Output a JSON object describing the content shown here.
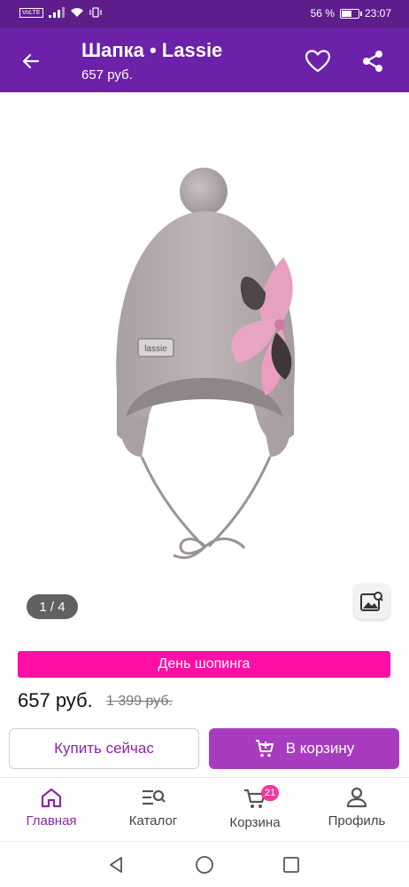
{
  "status_bar": {
    "network": "VoLTE",
    "battery_level": 0.56,
    "battery_percent": "56 %",
    "time": "23:07"
  },
  "header": {
    "title": "Шапка • Lassie",
    "subtitle": "657 руб."
  },
  "gallery": {
    "counter": "1 / 4",
    "image_label": "lassie"
  },
  "promo": {
    "label": "День шопинга"
  },
  "pricing": {
    "price": "657 руб.",
    "old_price": "1 399 руб."
  },
  "actions": {
    "buy_now": "Купить сейчас",
    "add_to_cart": "В корзину"
  },
  "bottom_nav": {
    "items": [
      {
        "label": "Главная",
        "icon": "home-icon",
        "active": true
      },
      {
        "label": "Каталог",
        "icon": "catalog-search-icon",
        "active": false
      },
      {
        "label": "Корзина",
        "icon": "cart-icon",
        "active": false,
        "badge": "21"
      },
      {
        "label": "Профиль",
        "icon": "profile-icon",
        "active": false
      }
    ]
  },
  "colors": {
    "status_bar": "#5e1d8a",
    "app_bar": "#6b21a8",
    "promo": "#ff0fa4",
    "primary_button": "#a83cbf",
    "accent": "#8e24aa"
  }
}
